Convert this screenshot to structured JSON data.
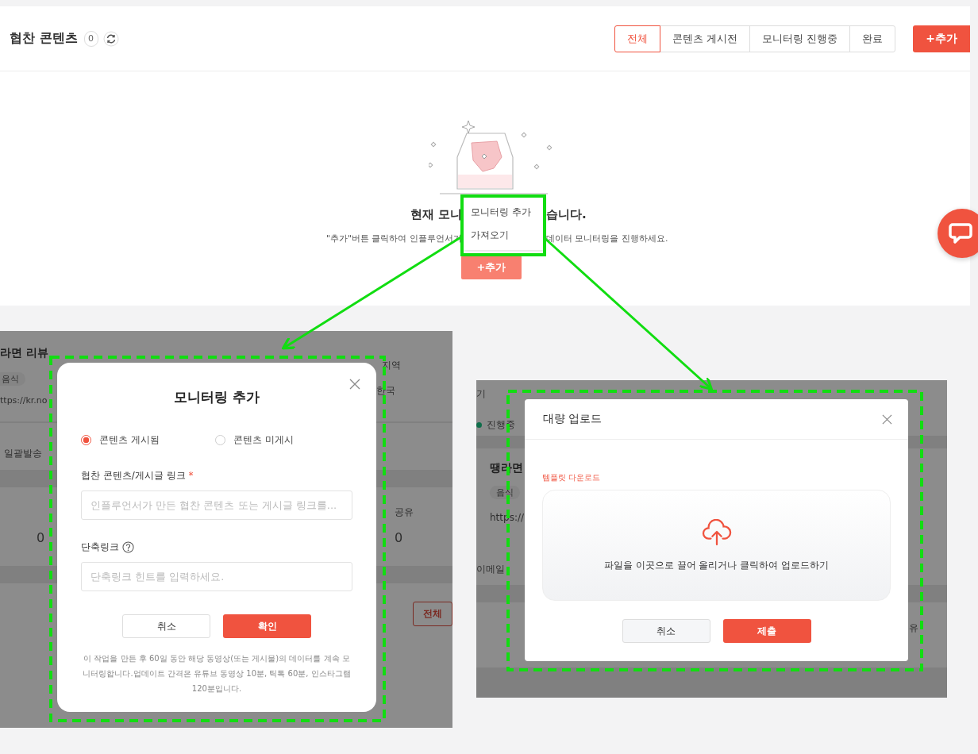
{
  "header": {
    "title": "협찬 콘텐츠",
    "count": "0"
  },
  "tabs": [
    {
      "label": "전체",
      "selected": true
    },
    {
      "label": "콘텐츠 게시전",
      "selected": false
    },
    {
      "label": "모니터링 진행중",
      "selected": false
    },
    {
      "label": "완료",
      "selected": false
    }
  ],
  "add_button": "+추가",
  "empty_state": {
    "title_parts": [
      "현재 모니",
      "습니다."
    ],
    "description_parts": [
      "\"추가\"버튼 클릭하여 인플루언서가",
      "데이터 모니터링을 진행하세요."
    ],
    "button": "+추가"
  },
  "dropdown_menu": {
    "items": [
      "모니터링 추가",
      "가져오기"
    ]
  },
  "monitoring_dialog": {
    "background_texts": [
      {
        "text": "라면 리뷰",
        "kind": "bold"
      },
      {
        "text": "음식",
        "kind": "chip"
      },
      {
        "text": "ttps://kr.no",
        "kind": "link"
      },
      {
        "text": "지역",
        "kind": "text"
      },
      {
        "text": "한국",
        "kind": "text"
      },
      {
        "text": "일괄발송",
        "kind": "text"
      },
      {
        "text": "0",
        "kind": "number"
      },
      {
        "text": "공유",
        "kind": "text"
      },
      {
        "text": "0",
        "kind": "number"
      },
      {
        "text": "전체",
        "kind": "button"
      }
    ],
    "title": "모니터링 추가",
    "radios": [
      {
        "label": "콘텐츠 게시됨",
        "selected": true
      },
      {
        "label": "콘텐츠 미게시",
        "selected": false
      }
    ],
    "link_label": "협찬 콘텐츠/게시글 링크",
    "required_mark": "*",
    "link_placeholder": "인플루언서가 만든 협찬 콘텐츠 또는 게시글 링크를...",
    "short_link_label": "단축링크",
    "short_link_placeholder": "단축링크 힌트를 입력하세요.",
    "cancel": "취소",
    "confirm": "확인",
    "note": "이 작업을 만든 후 60일 동안 해당 동영상(또는 게시물)의 데이터를 계속 모니터링합니다.업데이트 간격은 유튜브 동영상 10분, 틱톡 60분, 인스타그램 120분입니다."
  },
  "upload_dialog": {
    "background_texts": [
      {
        "text": "기",
        "kind": "text"
      },
      {
        "text": "진행중",
        "kind": "status"
      },
      {
        "text": "땡라면",
        "kind": "bold"
      },
      {
        "text": "음식",
        "kind": "chip"
      },
      {
        "text": "https://",
        "kind": "text"
      },
      {
        "text": "이메일",
        "kind": "text"
      },
      {
        "text": "유",
        "kind": "text"
      }
    ],
    "title": "대량 업로드",
    "template_link": "템플릿 다운로드",
    "drop_text": "파일을 이곳으로 끌어 올리거나 클릭하여 업로드하기",
    "cancel": "취소",
    "submit": "제출"
  }
}
